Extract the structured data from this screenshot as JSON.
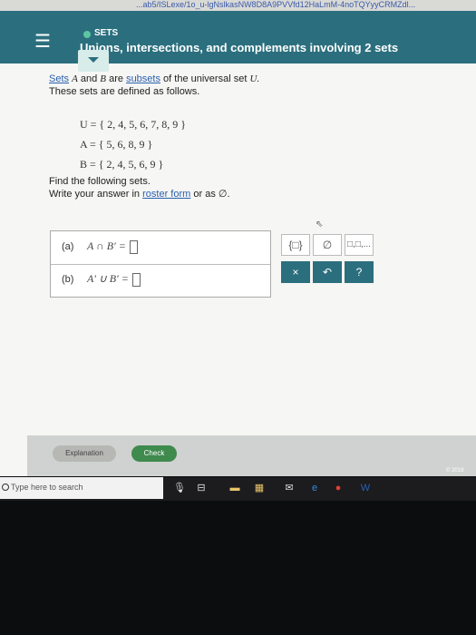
{
  "browser": {
    "url": "...ab5/ISLexe/1o_u-lgNslkasNW8D8A9PVVfd12HaLmM-4noTQYyyCRMZdl..."
  },
  "header": {
    "menu_icon": "hamburger-menu-icon",
    "topic": "SETS",
    "title": "Unions, intersections, and complements involving 2 sets"
  },
  "problem": {
    "intro_sets": "Sets",
    "intro_A": "A",
    "intro_and": "and",
    "intro_B": "B",
    "intro_are": "are",
    "intro_subsets": "subsets",
    "intro_rest": "of the universal set",
    "intro_U": "U.",
    "line2": "These sets are defined as follows.",
    "U_def": "U = { 2, 4, 5, 6, 7, 8, 9 }",
    "A_def": "A = { 5, 6, 8, 9 }",
    "B_def": "B = { 2, 4, 5, 6, 9 }",
    "find": "Find the following sets.",
    "write_prefix": "Write your answer in",
    "write_link": "roster form",
    "write_suffix": "or as ∅."
  },
  "answers": [
    {
      "label": "(a)",
      "expr": "A ∩ B′ ="
    },
    {
      "label": "(b)",
      "expr": "A′ ∪ B′ ="
    }
  ],
  "toolbox": {
    "braces": "{□}",
    "empty": "∅",
    "list": "□,□,...",
    "clear": "×",
    "undo": "↶",
    "help": "?"
  },
  "actions": {
    "explanation": "Explanation",
    "check": "Check"
  },
  "footer": {
    "copyright": "© 2019"
  },
  "taskbar": {
    "search_placeholder": "Type here to search"
  }
}
